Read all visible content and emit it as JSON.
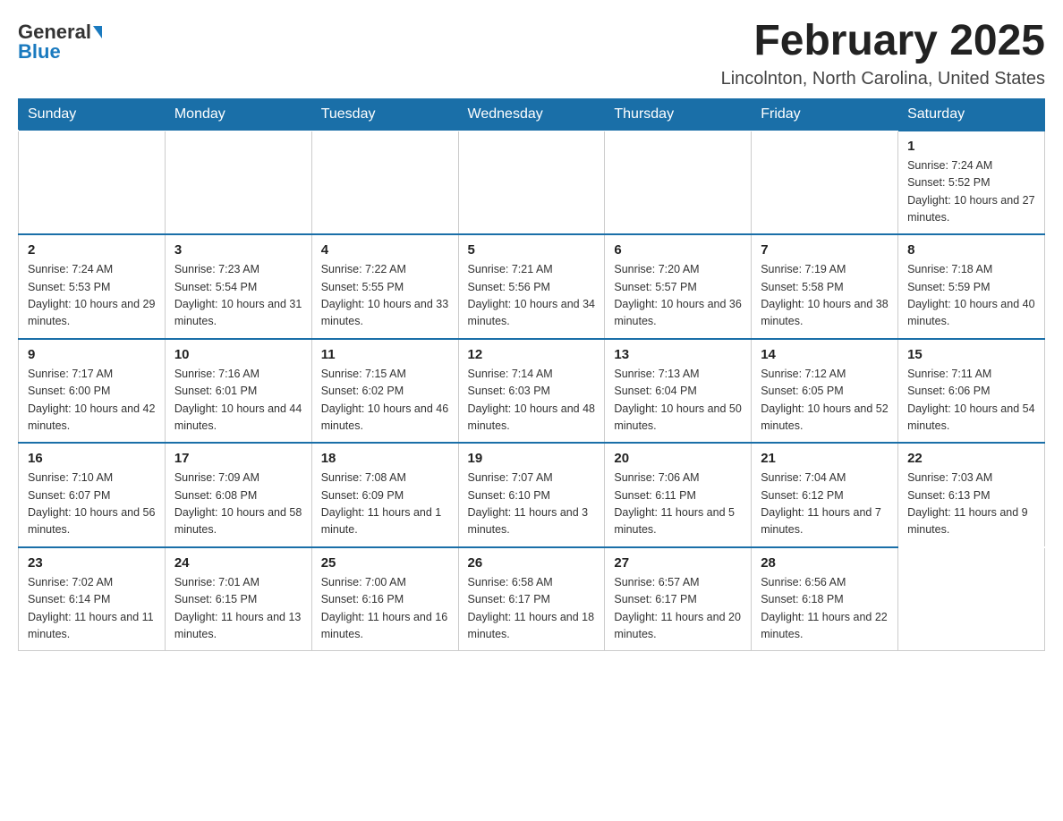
{
  "logo": {
    "general": "General",
    "blue": "Blue"
  },
  "header": {
    "month_title": "February 2025",
    "location": "Lincolnton, North Carolina, United States"
  },
  "days_of_week": [
    "Sunday",
    "Monday",
    "Tuesday",
    "Wednesday",
    "Thursday",
    "Friday",
    "Saturday"
  ],
  "weeks": [
    {
      "days": [
        {
          "number": "",
          "info": ""
        },
        {
          "number": "",
          "info": ""
        },
        {
          "number": "",
          "info": ""
        },
        {
          "number": "",
          "info": ""
        },
        {
          "number": "",
          "info": ""
        },
        {
          "number": "",
          "info": ""
        },
        {
          "number": "1",
          "info": "Sunrise: 7:24 AM\nSunset: 5:52 PM\nDaylight: 10 hours and 27 minutes."
        }
      ]
    },
    {
      "days": [
        {
          "number": "2",
          "info": "Sunrise: 7:24 AM\nSunset: 5:53 PM\nDaylight: 10 hours and 29 minutes."
        },
        {
          "number": "3",
          "info": "Sunrise: 7:23 AM\nSunset: 5:54 PM\nDaylight: 10 hours and 31 minutes."
        },
        {
          "number": "4",
          "info": "Sunrise: 7:22 AM\nSunset: 5:55 PM\nDaylight: 10 hours and 33 minutes."
        },
        {
          "number": "5",
          "info": "Sunrise: 7:21 AM\nSunset: 5:56 PM\nDaylight: 10 hours and 34 minutes."
        },
        {
          "number": "6",
          "info": "Sunrise: 7:20 AM\nSunset: 5:57 PM\nDaylight: 10 hours and 36 minutes."
        },
        {
          "number": "7",
          "info": "Sunrise: 7:19 AM\nSunset: 5:58 PM\nDaylight: 10 hours and 38 minutes."
        },
        {
          "number": "8",
          "info": "Sunrise: 7:18 AM\nSunset: 5:59 PM\nDaylight: 10 hours and 40 minutes."
        }
      ]
    },
    {
      "days": [
        {
          "number": "9",
          "info": "Sunrise: 7:17 AM\nSunset: 6:00 PM\nDaylight: 10 hours and 42 minutes."
        },
        {
          "number": "10",
          "info": "Sunrise: 7:16 AM\nSunset: 6:01 PM\nDaylight: 10 hours and 44 minutes."
        },
        {
          "number": "11",
          "info": "Sunrise: 7:15 AM\nSunset: 6:02 PM\nDaylight: 10 hours and 46 minutes."
        },
        {
          "number": "12",
          "info": "Sunrise: 7:14 AM\nSunset: 6:03 PM\nDaylight: 10 hours and 48 minutes."
        },
        {
          "number": "13",
          "info": "Sunrise: 7:13 AM\nSunset: 6:04 PM\nDaylight: 10 hours and 50 minutes."
        },
        {
          "number": "14",
          "info": "Sunrise: 7:12 AM\nSunset: 6:05 PM\nDaylight: 10 hours and 52 minutes."
        },
        {
          "number": "15",
          "info": "Sunrise: 7:11 AM\nSunset: 6:06 PM\nDaylight: 10 hours and 54 minutes."
        }
      ]
    },
    {
      "days": [
        {
          "number": "16",
          "info": "Sunrise: 7:10 AM\nSunset: 6:07 PM\nDaylight: 10 hours and 56 minutes."
        },
        {
          "number": "17",
          "info": "Sunrise: 7:09 AM\nSunset: 6:08 PM\nDaylight: 10 hours and 58 minutes."
        },
        {
          "number": "18",
          "info": "Sunrise: 7:08 AM\nSunset: 6:09 PM\nDaylight: 11 hours and 1 minute."
        },
        {
          "number": "19",
          "info": "Sunrise: 7:07 AM\nSunset: 6:10 PM\nDaylight: 11 hours and 3 minutes."
        },
        {
          "number": "20",
          "info": "Sunrise: 7:06 AM\nSunset: 6:11 PM\nDaylight: 11 hours and 5 minutes."
        },
        {
          "number": "21",
          "info": "Sunrise: 7:04 AM\nSunset: 6:12 PM\nDaylight: 11 hours and 7 minutes."
        },
        {
          "number": "22",
          "info": "Sunrise: 7:03 AM\nSunset: 6:13 PM\nDaylight: 11 hours and 9 minutes."
        }
      ]
    },
    {
      "days": [
        {
          "number": "23",
          "info": "Sunrise: 7:02 AM\nSunset: 6:14 PM\nDaylight: 11 hours and 11 minutes."
        },
        {
          "number": "24",
          "info": "Sunrise: 7:01 AM\nSunset: 6:15 PM\nDaylight: 11 hours and 13 minutes."
        },
        {
          "number": "25",
          "info": "Sunrise: 7:00 AM\nSunset: 6:16 PM\nDaylight: 11 hours and 16 minutes."
        },
        {
          "number": "26",
          "info": "Sunrise: 6:58 AM\nSunset: 6:17 PM\nDaylight: 11 hours and 18 minutes."
        },
        {
          "number": "27",
          "info": "Sunrise: 6:57 AM\nSunset: 6:17 PM\nDaylight: 11 hours and 20 minutes."
        },
        {
          "number": "28",
          "info": "Sunrise: 6:56 AM\nSunset: 6:18 PM\nDaylight: 11 hours and 22 minutes."
        },
        {
          "number": "",
          "info": ""
        }
      ]
    }
  ]
}
